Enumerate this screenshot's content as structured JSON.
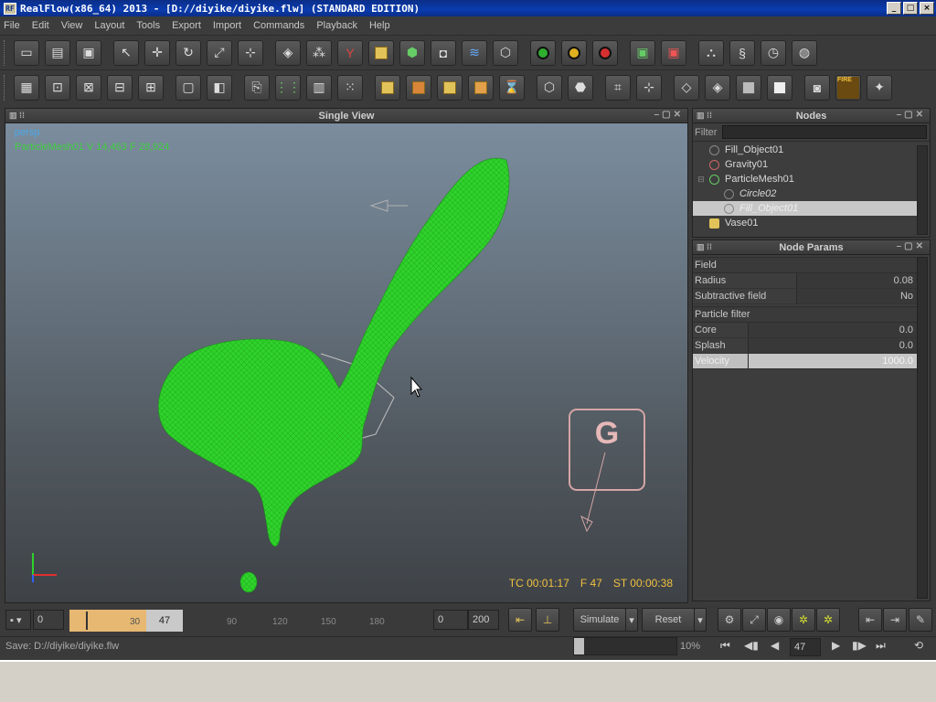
{
  "window": {
    "title": "RealFlow(x86_64) 2013 - [D://diyike/diyike.flw] (STANDARD EDITION)",
    "logo_text": "RF",
    "minimize": "_",
    "maximize": "□",
    "close": "×"
  },
  "menu": [
    "File",
    "Edit",
    "View",
    "Layout",
    "Tools",
    "Export",
    "Import",
    "Commands",
    "Playback",
    "Help"
  ],
  "viewport": {
    "title": "Single View",
    "camera": "persp",
    "info": "ParticleMesh01  V 14,463  F 28,924",
    "tc": "TC 00:01:17",
    "frame": "F 47",
    "st": "ST 00:00:38",
    "gravity_glyph": "G"
  },
  "nodes": {
    "title": "Nodes",
    "filter_label": "Filter",
    "items": [
      {
        "label": "Fill_Object01",
        "icon": "fill-object-icon",
        "level": 0,
        "tree": ""
      },
      {
        "label": "Gravity01",
        "icon": "gravity-icon",
        "level": 0,
        "tree": ""
      },
      {
        "label": "ParticleMesh01",
        "icon": "mesh-icon",
        "level": 0,
        "tree": "⊟"
      },
      {
        "label": "Circle02",
        "icon": "circle-icon",
        "level": 1,
        "tree": ""
      },
      {
        "label": "Fill_Object01",
        "icon": "fill-object-icon",
        "level": 1,
        "tree": ""
      },
      {
        "label": "Vase01",
        "icon": "object-icon",
        "level": 0,
        "tree": ""
      }
    ]
  },
  "params": {
    "title": "Node Params",
    "sections": [
      {
        "name": "Field",
        "rows": [
          {
            "label": "Radius",
            "value": "0.08"
          },
          {
            "label": "Subtractive field",
            "value": "No"
          }
        ]
      },
      {
        "name": "Particle filter",
        "rows": [
          {
            "label": "Core",
            "value": "0.0"
          },
          {
            "label": "Splash",
            "value": "0.0"
          },
          {
            "label": "Velocity",
            "value": "1000.0"
          }
        ]
      }
    ]
  },
  "timeline": {
    "start": "0",
    "current": "47",
    "ticks": [
      "30",
      "90",
      "120",
      "150",
      "180"
    ],
    "range_start": "0",
    "range_end": "200",
    "simulate": "Simulate",
    "reset": "Reset"
  },
  "status": {
    "text": "Save: D://diyike/diyike.flw",
    "progress_pct": "10%",
    "progress_value": 0.1,
    "frame": "47"
  },
  "colors": {
    "mesh": "#33e02f",
    "accent_yellow": "#f0c040",
    "cam_blue": "#4aa8e8"
  }
}
